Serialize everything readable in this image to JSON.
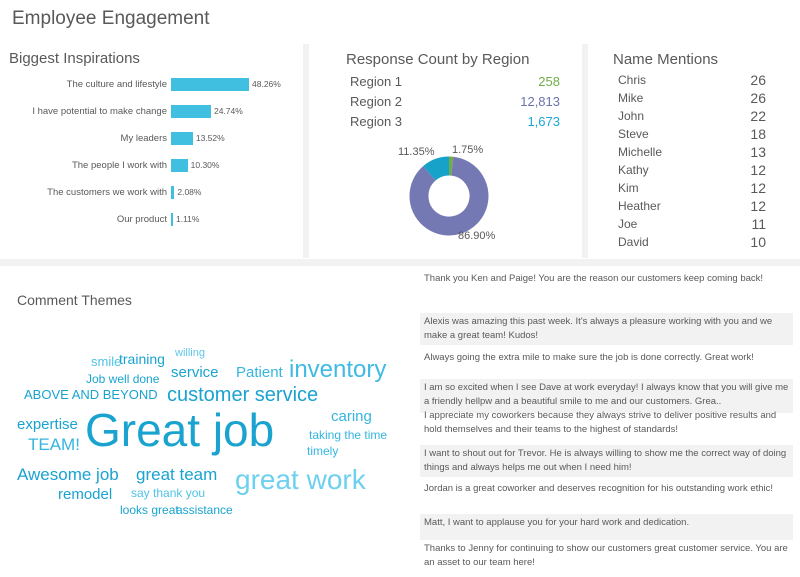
{
  "title": "Employee Engagement",
  "inspirations": {
    "title": "Biggest Inspirations",
    "items": [
      {
        "label": "The culture and lifestyle",
        "value": 48.26,
        "value_label": "48.26%"
      },
      {
        "label": "I have potential to make change",
        "value": 24.74,
        "value_label": "24.74%"
      },
      {
        "label": "My leaders",
        "value": 13.52,
        "value_label": "13.52%"
      },
      {
        "label": "The people I work with",
        "value": 10.3,
        "value_label": "10.30%"
      },
      {
        "label": "The customers we work with",
        "value": 2.08,
        "value_label": "2.08%"
      },
      {
        "label": "Our product",
        "value": 1.11,
        "value_label": "1.11%"
      }
    ],
    "bar_color": "#41bfe0"
  },
  "regions": {
    "title": "Response Count by Region",
    "items": [
      {
        "name": "Region 1",
        "count": "258",
        "color": "#70ad47"
      },
      {
        "name": "Region 2",
        "count": "12,813",
        "color": "#6b73ad"
      },
      {
        "name": "Region 3",
        "count": "1,673",
        "color": "#1aa6d6"
      }
    ],
    "donut": {
      "slices": [
        {
          "label": "1.75%",
          "value": 1.75,
          "color": "#70ad47"
        },
        {
          "label": "86.90%",
          "value": 86.9,
          "color": "#7479b4"
        },
        {
          "label": "11.35%",
          "value": 11.35,
          "color": "#17a2c9"
        }
      ]
    }
  },
  "names": {
    "title": "Name Mentions",
    "items": [
      {
        "name": "Chris",
        "count": "26"
      },
      {
        "name": "Mike",
        "count": "26"
      },
      {
        "name": "John",
        "count": "22"
      },
      {
        "name": "Steve",
        "count": "18"
      },
      {
        "name": "Michelle",
        "count": "13"
      },
      {
        "name": "Kathy",
        "count": "12"
      },
      {
        "name": "Kim",
        "count": "12"
      },
      {
        "name": "Heather",
        "count": "12"
      },
      {
        "name": "Joe",
        "count": "11"
      },
      {
        "name": "David",
        "count": "10"
      }
    ]
  },
  "themes": {
    "title": "Comment Themes",
    "words": [
      "smile",
      "training",
      "willing",
      "service",
      "Patient",
      "inventory",
      "Job well done",
      "ABOVE AND BEYOND",
      "customer service",
      "caring",
      "expertise",
      "Great job",
      "taking the time",
      "TEAM!",
      "timely",
      "Awesome job",
      "great team",
      "great work",
      "remodel",
      "say thank you",
      "looks great",
      "assistance"
    ]
  },
  "comments": [
    "Thank you Ken and Paige! You are the reason our customers keep coming back!",
    "Alexis was amazing this past week. It's always a pleasure working with you and we make a great team! Kudos!",
    "Always going the extra mile to make sure the job is done correctly. Great work!",
    "I am so excited when I see Dave at work everyday! I always know that you will give me a friendly hellpw and a beautiful smile to me and our customers. Grea..",
    "I appreciate my coworkers because they always strive to deliver positive results and hold themselves and their teams to the highest of standards!",
    "I want to shout out for Trevor. He is always willing to show me the correct way of doing things and always helps me out when I need him!",
    "Jordan is a great coworker and deserves recognition for his outstanding work ethic!",
    "Matt, I want to applause you for your hard work and dedication.",
    "Thanks to Jenny for continuing to show our customers great customer service. You are an asset to our team here!"
  ]
}
